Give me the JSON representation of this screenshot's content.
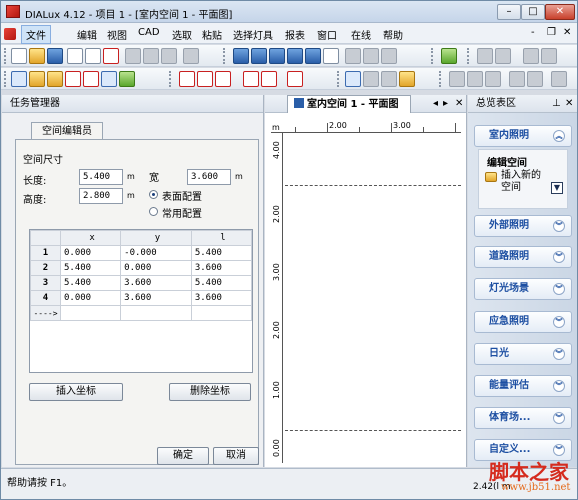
{
  "window": {
    "title": "DIALux 4.12 - 项目 1 - [室内空间 1 - 平面图]"
  },
  "menu": [
    "文件",
    "编辑",
    "视图",
    "CAD",
    "选取",
    "粘贴",
    "选择灯具",
    "报表",
    "窗口",
    "在线",
    "帮助"
  ],
  "task_manager": {
    "title": "任务管理器",
    "tab": "空间编辑员",
    "group_label": "空间尺寸",
    "length_label": "长度:",
    "length_value": "5.400",
    "length_unit": "m",
    "width_label": "宽",
    "width_value": "3.600",
    "width_unit": "m",
    "height_label": "高度:",
    "height_value": "2.800",
    "height_unit": "m",
    "radio_surface": "表面配置",
    "radio_common": "常用配置",
    "grid": {
      "columns": [
        "x",
        "y",
        "l"
      ],
      "rows": [
        {
          "n": "1",
          "x": "0.000",
          "y": "-0.000",
          "l": "5.400"
        },
        {
          "n": "2",
          "x": "5.400",
          "y": "0.000",
          "l": "3.600"
        },
        {
          "n": "3",
          "x": "5.400",
          "y": "3.600",
          "l": "5.400"
        },
        {
          "n": "4",
          "x": "0.000",
          "y": "3.600",
          "l": "3.600"
        }
      ],
      "new_row_marker": "---->"
    },
    "insert_button": "插入坐标",
    "delete_button": "删除坐标",
    "ok_button": "确定",
    "cancel_button": "取消"
  },
  "document": {
    "tab": "室内空间 1 - 平面图",
    "ruler_unit": "m",
    "ruler_top": [
      "2.00",
      "3.00"
    ],
    "ruler_left": [
      "4.00",
      "2.00",
      "3.00",
      "2.00",
      "1.00",
      "0.00"
    ]
  },
  "guide": {
    "title": "总览表区",
    "buttons": [
      "室内照明",
      "外部照明",
      "道路照明",
      "灯光场景",
      "应急照明",
      "日光",
      "能量评估",
      "体育场...",
      "自定义..."
    ],
    "sub_heading": "编辑空间",
    "sub_action": "插入新的空间"
  },
  "status": {
    "help_text": "帮助请按 F1。",
    "coords": "2.42(l m"
  },
  "watermark": {
    "main": "脚本之家",
    "url": "www.jb51.net"
  }
}
